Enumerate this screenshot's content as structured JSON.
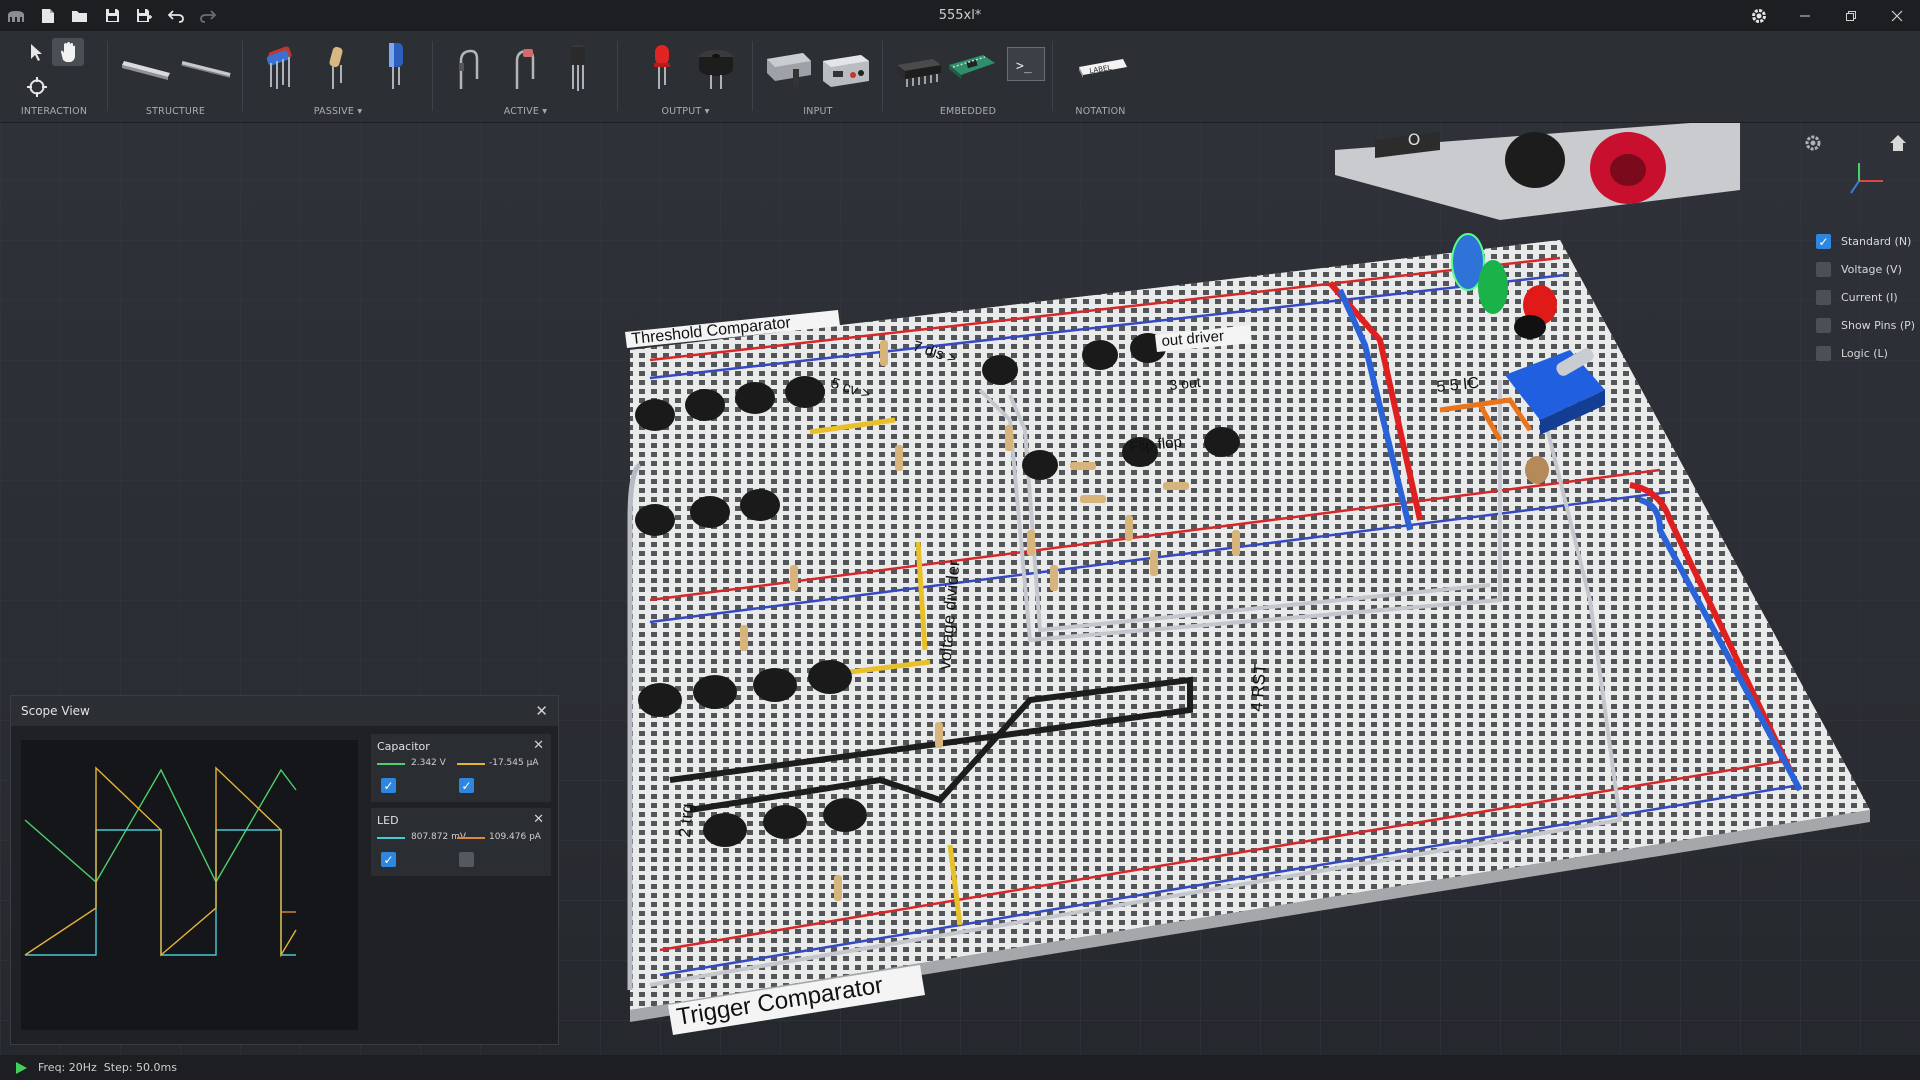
{
  "window": {
    "title": "555xl*"
  },
  "toolbar": {
    "groups": {
      "interaction": "INTERACTION",
      "structure": "STRUCTURE",
      "passive": "PASSIVE",
      "active": "ACTIVE",
      "output": "OUTPUT",
      "input": "INPUT",
      "embedded": "EMBEDDED",
      "notation": "NOTATION"
    },
    "notation_tag": "LABEL",
    "terminal_glyph": ">_"
  },
  "board_labels": {
    "threshold": "Threshold Comparator",
    "dis": "7 dis >",
    "cv": "5 cv >",
    "output_driver": "out driver",
    "out": "3 out",
    "flipflop": "Flip flop",
    "ic": "5 5 IC",
    "voltage_divider": "voltage divider",
    "rst": "4 RST",
    "trg": "2 trg",
    "trigger": "Trigger Comparator",
    "power_switch": "O"
  },
  "scope": {
    "title": "Scope View",
    "channels": [
      {
        "name": "Capacitor",
        "value1": "2.342 V",
        "value2": "-17.545 µA",
        "check1": true,
        "check2": true
      },
      {
        "name": "LED",
        "value1": "807.872 mV",
        "value2": "109.476 pA",
        "check1": true,
        "check2": false
      }
    ]
  },
  "view_options": [
    {
      "label": "Standard (N)",
      "checked": true
    },
    {
      "label": "Voltage (V)",
      "checked": false
    },
    {
      "label": "Current (I)",
      "checked": false
    },
    {
      "label": "Show Pins (P)",
      "checked": false
    },
    {
      "label": "Logic (L)",
      "checked": false
    }
  ],
  "status": {
    "text": "Freq: 20Hz  Step: 50.0ms"
  },
  "colors": {
    "accent": "#2e86de",
    "trace_green": "#4fcf6b",
    "trace_cyan": "#48c9d6",
    "trace_yellow": "#e6b23a",
    "trace_orange": "#e0883a"
  }
}
